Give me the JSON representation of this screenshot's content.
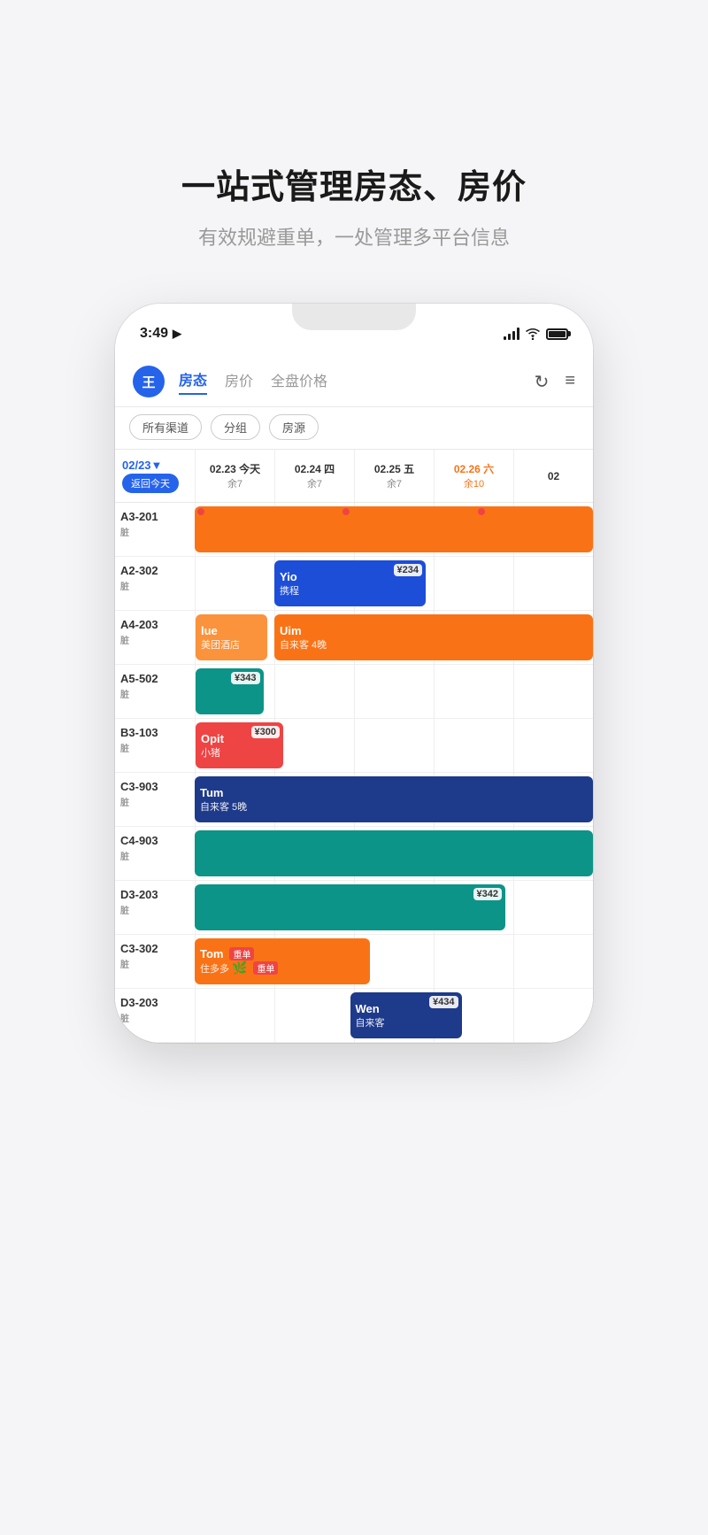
{
  "page": {
    "title": "一站式管理房态、房价",
    "subtitle": "有效规避重单，一处管理多平台信息"
  },
  "status_bar": {
    "time": "3:49",
    "location_icon": "▲"
  },
  "tabs": {
    "avatar": "王",
    "items": [
      {
        "label": "房态",
        "active": true
      },
      {
        "label": "房价",
        "active": false
      },
      {
        "label": "全盘价格",
        "active": false
      }
    ],
    "refresh_label": "↻",
    "menu_label": "≡"
  },
  "filters": [
    {
      "label": "所有渠道"
    },
    {
      "label": "分组"
    },
    {
      "label": "房源"
    }
  ],
  "calendar": {
    "date_nav": "02/23▼",
    "back_btn": "返回今天",
    "columns": [
      {
        "date": "02.23 今天",
        "remain": "余7",
        "is_today": true
      },
      {
        "date": "02.24 四",
        "remain": "余7"
      },
      {
        "date": "02.25 五",
        "remain": "余7"
      },
      {
        "date": "02.26 六",
        "remain": "余10",
        "is_weekend": true
      },
      {
        "date": "02",
        "remain": ""
      }
    ],
    "rows": [
      {
        "room": "A3-201",
        "tag": "脏",
        "bookings": [
          {
            "name": "",
            "source": "",
            "color": "orange",
            "start": 0,
            "span": 5,
            "has_alerts": true,
            "alert_positions": [
              0,
              1.5,
              3
            ]
          }
        ]
      },
      {
        "room": "A2-302",
        "tag": "脏",
        "bookings": [
          {
            "name": "Yio",
            "source": "携程",
            "color": "blue",
            "start": 1,
            "span": 2,
            "price": "¥234"
          }
        ]
      },
      {
        "room": "A4-203",
        "tag": "脏",
        "bookings": [
          {
            "name": "lue",
            "source": "美团酒店",
            "color": "orange",
            "start": 0,
            "span": 1
          },
          {
            "name": "Uim",
            "source": "自来客 4晚",
            "color": "orange",
            "start": 1,
            "span": 4
          }
        ]
      },
      {
        "room": "A5-502",
        "tag": "脏",
        "bookings": [
          {
            "name": "",
            "source": "",
            "color": "teal",
            "start": 0,
            "span": 1,
            "price": "¥343"
          },
          {
            "name": "",
            "source": "",
            "color": "striped",
            "start": 1,
            "span": 2
          }
        ]
      },
      {
        "room": "B3-103",
        "tag": "脏",
        "bookings": [
          {
            "name": "Opit",
            "source": "小猪",
            "color": "red",
            "start": 0,
            "span": 1.2,
            "price": "¥300"
          }
        ]
      },
      {
        "room": "C3-903",
        "tag": "脏",
        "bookings": [
          {
            "name": "Tum",
            "source": "自来客 5晚",
            "color": "blue-dark",
            "start": 0,
            "span": 5
          }
        ]
      },
      {
        "room": "C4-903",
        "tag": "脏",
        "bookings": [
          {
            "name": "",
            "source": "",
            "color": "teal",
            "start": 0,
            "span": 5
          }
        ]
      },
      {
        "room": "D3-203",
        "tag": "脏",
        "bookings": [
          {
            "name": "",
            "source": "",
            "color": "teal",
            "start": 0,
            "span": 4,
            "price": "¥342"
          }
        ]
      },
      {
        "room": "C3-302",
        "tag": "脏",
        "bookings": [
          {
            "name": "Tom",
            "source": "住多多",
            "color": "orange",
            "start": 0,
            "span": 2.2,
            "badge1": "重单",
            "badge2": "重单",
            "has_leaf": true
          }
        ]
      },
      {
        "room": "D3-203",
        "tag": "脏",
        "bookings": [
          {
            "name": "Wen",
            "source": "自来客",
            "color": "blue-dark",
            "start": 2,
            "span": 1.5,
            "price": "¥434"
          }
        ]
      }
    ]
  }
}
